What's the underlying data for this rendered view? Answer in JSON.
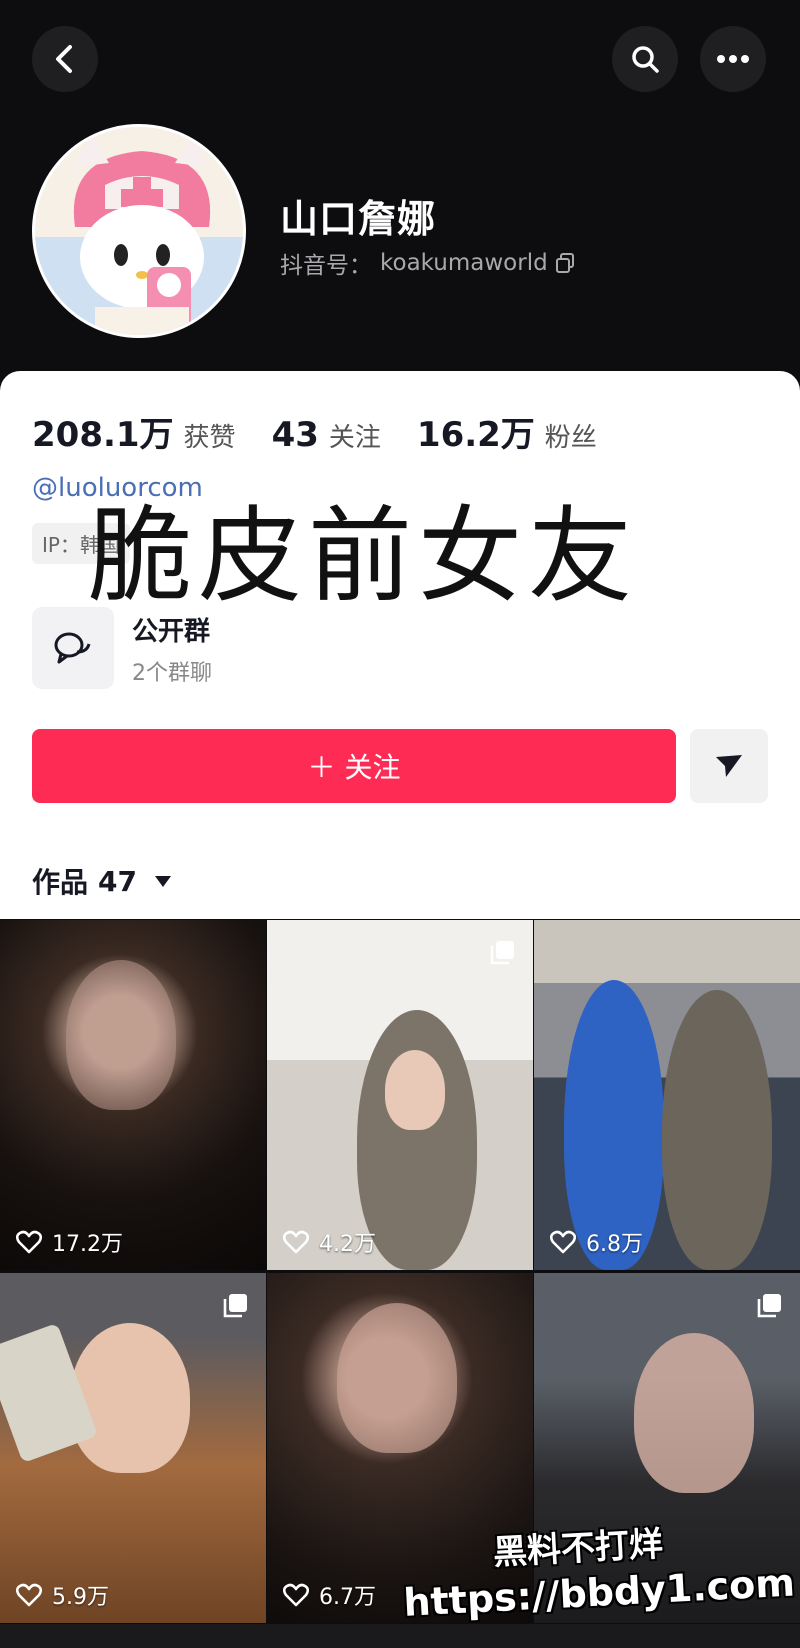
{
  "header": {
    "name": "山口詹娜",
    "account_label": "抖音号：",
    "account_id": "koakumaworld",
    "icons": [
      "back-arrow-icon",
      "search-icon",
      "more-icon",
      "copy-icon"
    ]
  },
  "stats": [
    {
      "value": "208.1万",
      "label": "获赞"
    },
    {
      "value": "43",
      "label": "关注"
    },
    {
      "value": "16.2万",
      "label": "粉丝"
    }
  ],
  "profile": {
    "handle": "@luoluorcom",
    "ip": "IP：韩国"
  },
  "overlay_caption": "脆皮前女友",
  "group": {
    "title": "公开群",
    "subtitle": "2个群聊"
  },
  "actions": {
    "follow_label": "＋ 关注"
  },
  "works": {
    "label": "作品",
    "count": "47"
  },
  "videos": [
    {
      "likes": "17.2万",
      "multi": false
    },
    {
      "likes": "4.2万",
      "multi": true
    },
    {
      "likes": "6.8万",
      "multi": false
    },
    {
      "likes": "5.9万",
      "multi": true
    },
    {
      "likes": "6.7万",
      "multi": false
    },
    {
      "likes": "",
      "multi": true
    }
  ],
  "watermark": {
    "line1": "黑料不打烊",
    "line2": "https://bbdy1.com"
  },
  "colors": {
    "accent": "#fe2c55",
    "header_bg": "#0d0d0f",
    "link": "#4a6fb5"
  }
}
